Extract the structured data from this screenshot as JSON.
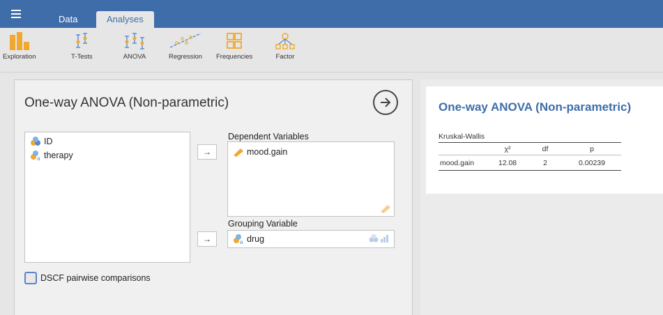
{
  "tabs": {
    "data": "Data",
    "analyses": "Analyses"
  },
  "ribbon": [
    {
      "key": "exploration",
      "label": "Exploration"
    },
    {
      "key": "ttests",
      "label": "T-Tests"
    },
    {
      "key": "anova",
      "label": "ANOVA"
    },
    {
      "key": "regression",
      "label": "Regression"
    },
    {
      "key": "frequencies",
      "label": "Frequencies"
    },
    {
      "key": "factor",
      "label": "Factor"
    }
  ],
  "options": {
    "title": "One-way ANOVA (Non-parametric)",
    "variables": [
      {
        "name": "ID",
        "icon": "nominal-integer-icon"
      },
      {
        "name": "therapy",
        "icon": "nominal-text-icon"
      }
    ],
    "dependent_label": "Dependent Variables",
    "dependent_vars": [
      {
        "name": "mood.gain",
        "icon": "continuous-icon"
      }
    ],
    "grouping_label": "Grouping Variable",
    "grouping_var": {
      "name": "drug",
      "icon": "nominal-text-icon"
    },
    "move_arrow": "→",
    "dscf_label": "DSCF pairwise comparisons",
    "dscf_checked": false
  },
  "results": {
    "title": "One-way ANOVA (Non-parametric)",
    "table_title": "Kruskal-Wallis",
    "columns": [
      "",
      "χ²",
      "df",
      "p"
    ],
    "rows": [
      {
        "var": "mood.gain",
        "chi2": "12.08",
        "df": "2",
        "p": "0.00239"
      }
    ]
  },
  "colors": {
    "brand": "#3e6da9",
    "icon_orange": "#f0a830",
    "checkbox_border": "#5b86c4"
  }
}
